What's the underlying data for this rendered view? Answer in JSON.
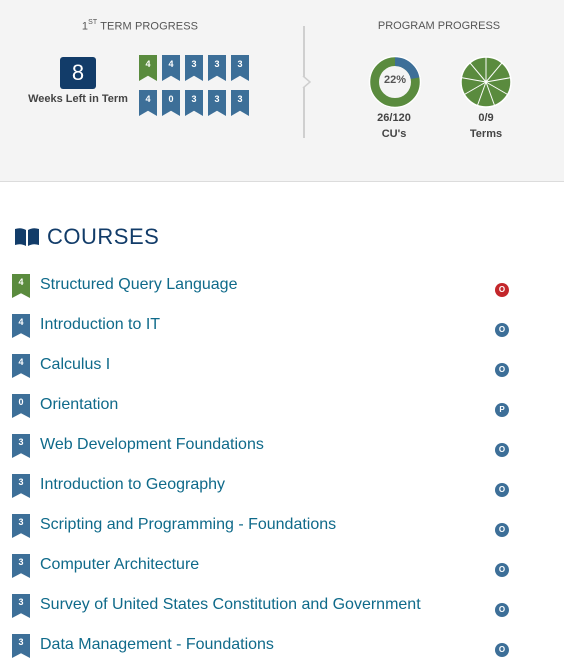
{
  "term_progress": {
    "title_num": "1",
    "title_sup": "ST",
    "title_rest": " TERM PROGRESS",
    "weeks_left": "8",
    "weeks_label": "Weeks Left in Term",
    "course_flags": [
      {
        "cu": "4",
        "done": true
      },
      {
        "cu": "4",
        "done": false
      },
      {
        "cu": "3",
        "done": false
      },
      {
        "cu": "3",
        "done": false
      },
      {
        "cu": "3",
        "done": false
      },
      {
        "cu": "4",
        "done": false
      },
      {
        "cu": "0",
        "done": false
      },
      {
        "cu": "3",
        "done": false
      },
      {
        "cu": "3",
        "done": false
      },
      {
        "cu": "3",
        "done": false
      }
    ]
  },
  "program_progress": {
    "title": "PROGRAM PROGRESS",
    "cu_percent": "22%",
    "cu_fraction": 0.22,
    "cu_value": "26/120",
    "cu_label": "CU's",
    "terms_value": "0/9",
    "terms_label": "Terms",
    "terms_total": 9
  },
  "colors": {
    "navy": "#123c69",
    "blue": "#3d6f98",
    "green": "#5a8b3e",
    "link": "#0f6a8a",
    "alert": "#c3272b"
  },
  "courses": {
    "title": "COURSES",
    "items": [
      {
        "cu": "4",
        "name": "Structured Query Language",
        "status": "O",
        "done": true,
        "alert": true
      },
      {
        "cu": "4",
        "name": "Introduction to IT",
        "status": "O",
        "done": false,
        "alert": false
      },
      {
        "cu": "4",
        "name": "Calculus I",
        "status": "O",
        "done": false,
        "alert": false
      },
      {
        "cu": "0",
        "name": "Orientation",
        "status": "P",
        "done": false,
        "alert": false
      },
      {
        "cu": "3",
        "name": "Web Development Foundations",
        "status": "O",
        "done": false,
        "alert": false
      },
      {
        "cu": "3",
        "name": "Introduction to Geography",
        "status": "O",
        "done": false,
        "alert": false
      },
      {
        "cu": "3",
        "name": "Scripting and Programming - Foundations",
        "status": "O",
        "done": false,
        "alert": false
      },
      {
        "cu": "3",
        "name": "Computer Architecture",
        "status": "O",
        "done": false,
        "alert": false
      },
      {
        "cu": "3",
        "name": "Survey of United States Constitution and Government",
        "status": "O",
        "done": false,
        "alert": false
      },
      {
        "cu": "3",
        "name": "Data Management - Foundations",
        "status": "O",
        "done": false,
        "alert": false
      }
    ]
  }
}
